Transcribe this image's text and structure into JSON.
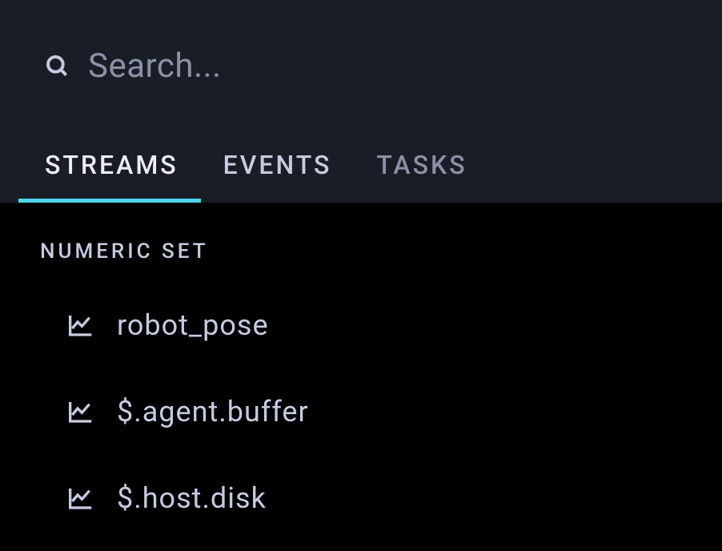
{
  "search": {
    "placeholder": "Search..."
  },
  "tabs": [
    {
      "label": "STREAMS",
      "active": true
    },
    {
      "label": "EVENTS",
      "active": false
    },
    {
      "label": "TASKS",
      "active": false
    }
  ],
  "section": {
    "header": "NUMERIC SET",
    "streams": [
      {
        "label": "robot_pose"
      },
      {
        "label": "$.agent.buffer"
      },
      {
        "label": "$.host.disk"
      }
    ]
  }
}
